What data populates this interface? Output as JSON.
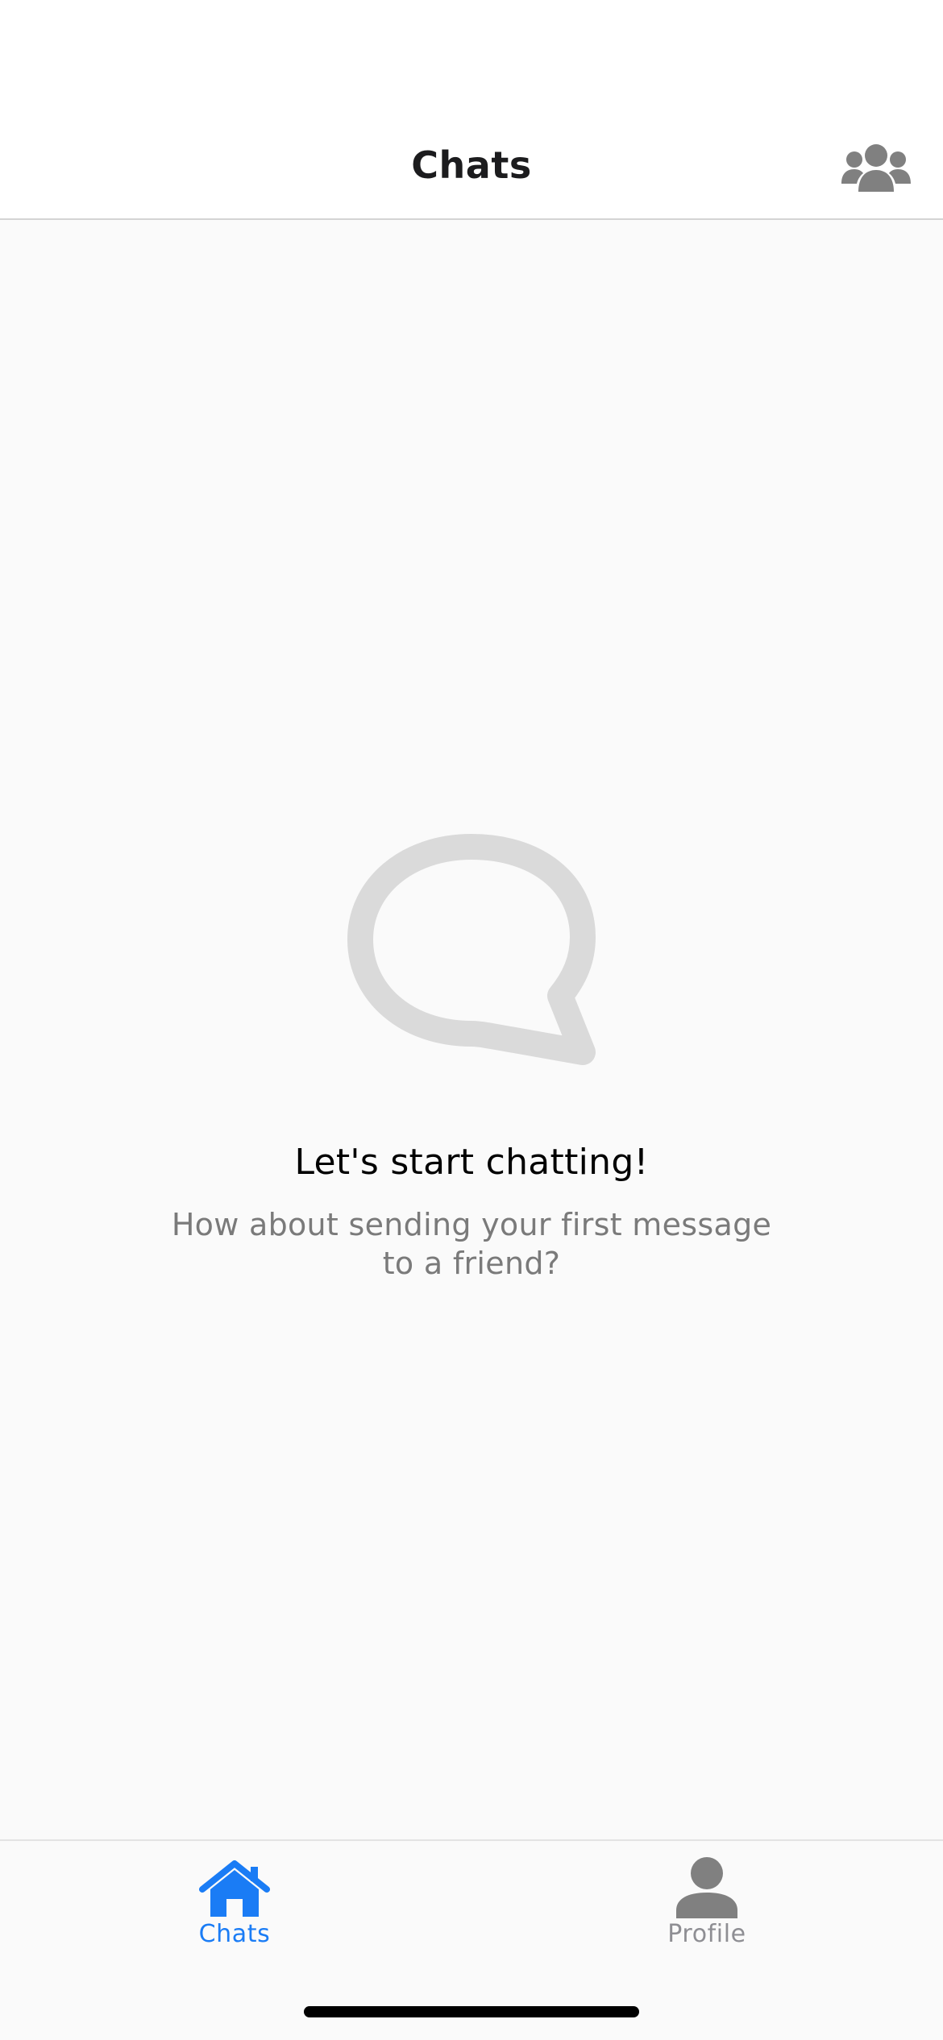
{
  "header": {
    "title": "Chats",
    "group_icon": "people-group-icon"
  },
  "empty_state": {
    "icon": "chat-bubble-icon",
    "title": "Let's start chatting!",
    "subtitle": "How about sending your first message to a friend?"
  },
  "tab_bar": {
    "tabs": [
      {
        "label": "Chats",
        "icon": "home-icon",
        "active": true
      },
      {
        "label": "Profile",
        "icon": "person-icon",
        "active": false
      }
    ]
  },
  "colors": {
    "accent": "#1a7cf5",
    "inactive": "#8e8e93",
    "icon_gray": "#808080",
    "bubble_gray": "#dadada",
    "content_background": "#fafafa"
  }
}
